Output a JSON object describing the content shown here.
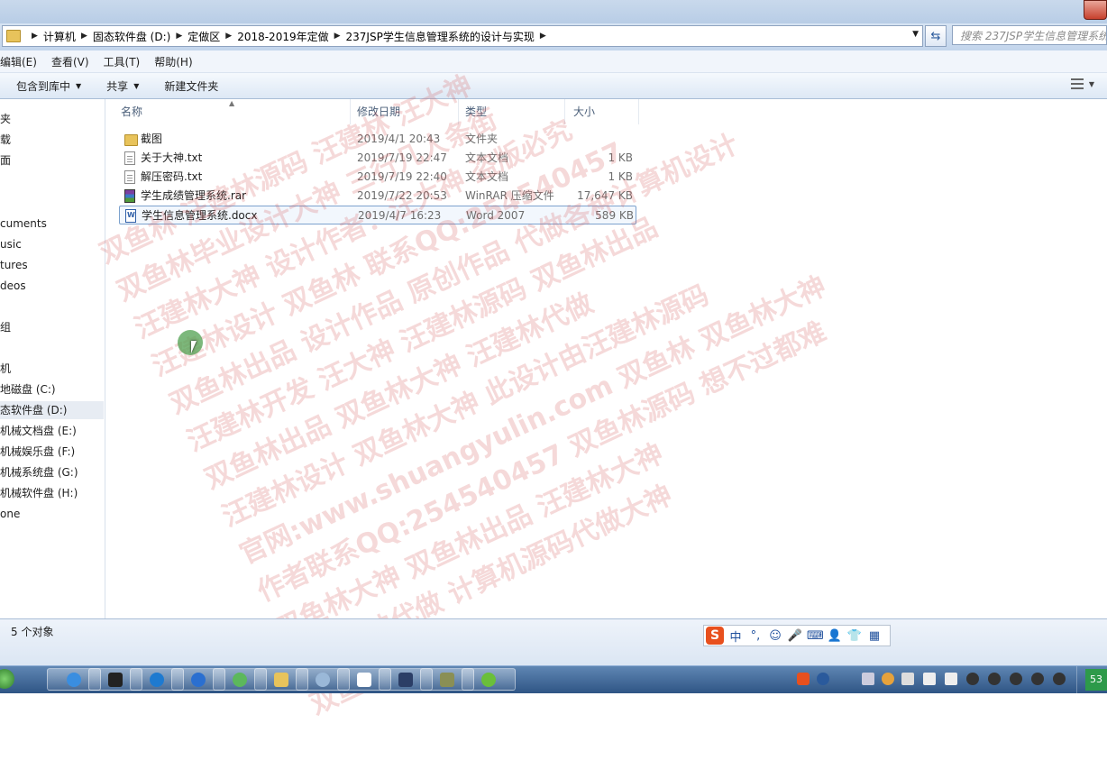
{
  "address_bar": {
    "crumbs": [
      "计算机",
      "固态软件盘 (D:)",
      "定做区",
      "2018-2019年定做",
      "237JSP学生信息管理系统的设计与实现"
    ],
    "search_placeholder": "搜索 237JSP学生信息管理系统..."
  },
  "menubar": {
    "items": [
      "编辑(E)",
      "查看(V)",
      "工具(T)",
      "帮助(H)"
    ]
  },
  "toolbar": {
    "include_label": "包含到库中",
    "share_label": "共享",
    "new_folder_label": "新建文件夹"
  },
  "nav": {
    "items": [
      "夹",
      "载",
      "面",
      "cuments",
      "usic",
      "tures",
      "deos",
      "组",
      "机",
      "地磁盘 (C:)",
      "态软件盘 (D:)",
      "机械文档盘 (E:)",
      "机械娱乐盘 (F:)",
      "机械系统盘 (G:)",
      "机械软件盘 (H:)",
      "one"
    ],
    "selected_index": 10
  },
  "columns": {
    "name": "名称",
    "modified": "修改日期",
    "type": "类型",
    "size": "大小"
  },
  "files": [
    {
      "name": "截图",
      "modified": "2019/4/1 20:43",
      "type": "文件夹",
      "size": "",
      "icon": "folder-icon"
    },
    {
      "name": "关于大神.txt",
      "modified": "2019/7/19 22:47",
      "type": "文本文档",
      "size": "1 KB",
      "icon": "text-file-icon"
    },
    {
      "name": "解压密码.txt",
      "modified": "2019/7/19 22:40",
      "type": "文本文档",
      "size": "1 KB",
      "icon": "text-file-icon"
    },
    {
      "name": "学生成绩管理系统.rar",
      "modified": "2019/7/22 20:53",
      "type": "WinRAR 压缩文件",
      "size": "17,647 KB",
      "icon": "rar-archive-icon"
    },
    {
      "name": "学生信息管理系统.docx",
      "modified": "2019/4/7 16:23",
      "type": "Word 2007",
      "size": "589 KB",
      "icon": "word-doc-icon"
    }
  ],
  "selected_file_index": 4,
  "status": {
    "count_text": "5 个对象"
  },
  "watermark": {
    "lines": [
      "双鱼林  汪建林源码  汪建林  汪大神",
      "双鱼林毕业设计大神  三行几人条街",
      "汪建林大神  设计作者：汪大神  盗版必究",
      "汪建林设计  双鱼林  联系QQ:254540457",
      "双鱼林出品  设计作品  原创作品  代做各种计算机设计",
      "汪建林开发  汪大神  汪建林源码  双鱼林出品",
      "双鱼林出品  双鱼林大神  汪建林代做",
      "汪建林设计  双鱼林大神  此设计由汪建林源码",
      "官网:www.shuangyulin.com  双鱼林  双鱼林大神",
      "作者联系QQ:254540457  双鱼林源码  想不过都难",
      "双鱼林大神  双鱼林出品  汪建林大神",
      "选汪大神代做  计算机源码代做大神",
      "双鱼林大神"
    ]
  },
  "ime": {
    "logo": "S",
    "mode": "中",
    "items": [
      "°,",
      "☺",
      "🎤",
      "⌨",
      "👤",
      "👕",
      "▦"
    ]
  },
  "colors": {
    "accent": "#3b6aa0",
    "taskbar": "#2f5585",
    "watermark": "#d25050"
  }
}
